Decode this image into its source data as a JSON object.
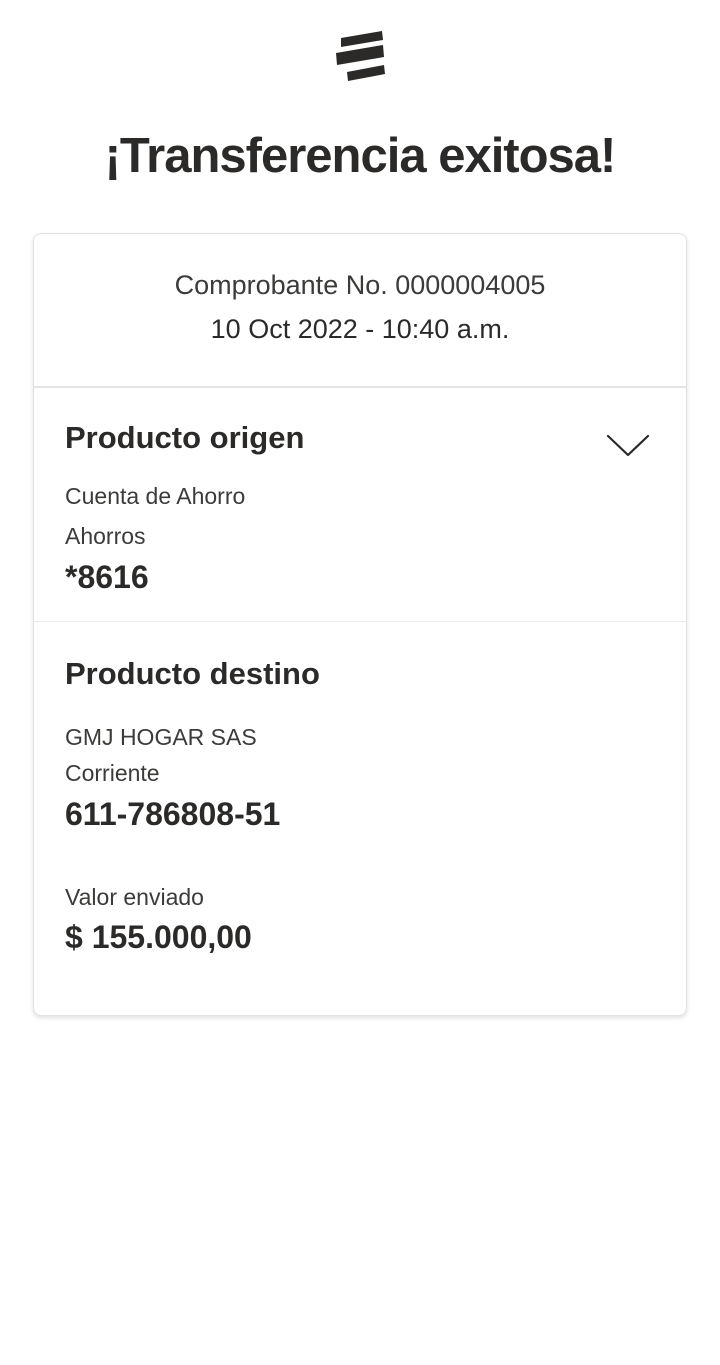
{
  "header": {
    "logo_icon": "bancolombia-logo-icon",
    "title": "¡Transferencia exitosa!"
  },
  "receipt": {
    "number": "Comprobante No. 0000004005",
    "datetime": "10 Oct 2022 - 10:40 a.m."
  },
  "origin": {
    "title": "Producto origen",
    "expand_icon": "chevron-down-icon",
    "product_type": "Cuenta de Ahorro",
    "account_kind": "Ahorros",
    "account_number": "*8616"
  },
  "destination": {
    "title": "Producto destino",
    "holder": "GMJ HOGAR SAS",
    "account_kind": "Corriente",
    "account_number": "611-786808-51",
    "amount_label": "Valor enviado",
    "amount": "$ 155.000,00"
  },
  "colors": {
    "text": "#2b2a29",
    "border": "#e2e2e2",
    "background": "#ffffff"
  }
}
